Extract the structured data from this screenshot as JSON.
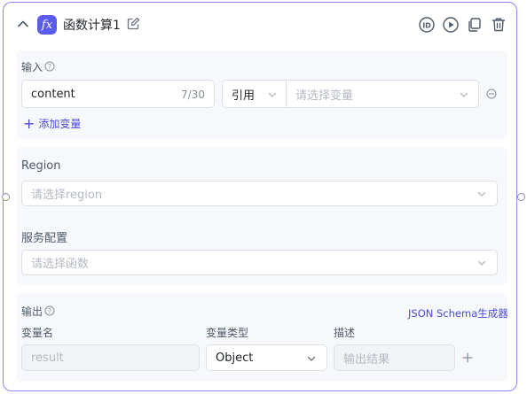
{
  "node": {
    "title": "函数计算1",
    "icon": "fx-icon",
    "accent": "#5b5bf0",
    "border_color": "#8b86f5"
  },
  "header_actions": [
    "id-icon",
    "play-icon",
    "copy-icon",
    "trash-icon"
  ],
  "input_section": {
    "label": "输入",
    "param": {
      "name_value": "content",
      "counter": "7/30",
      "mode_value": "引用",
      "variable_placeholder": "请选择变量"
    },
    "add_variable_label": "添加变量"
  },
  "config_section": {
    "region_label": "Region",
    "region_placeholder": "请选择region",
    "service_label": "服务配置",
    "service_placeholder": "请选择函数"
  },
  "output_section": {
    "label": "输出",
    "json_schema_link": "JSON Schema生成器",
    "columns": {
      "name": "变量名",
      "type": "变量类型",
      "desc": "描述"
    },
    "row": {
      "name_value": "result",
      "type_value": "Object",
      "desc_value": "输出结果"
    }
  }
}
